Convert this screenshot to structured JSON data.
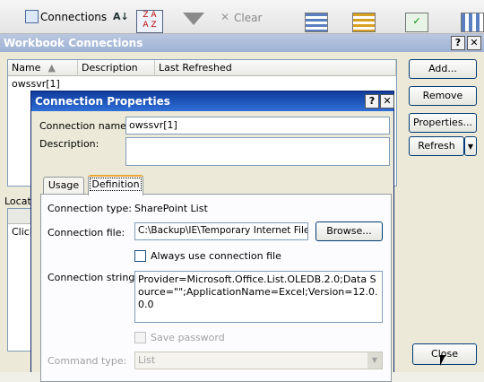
{
  "ribbon": {
    "connections_label": "Connections",
    "clear_label": "Clear"
  },
  "outer": {
    "title": "Workbook Connections",
    "columns": [
      "Name",
      "Description",
      "Last Refreshed"
    ],
    "rows": [
      {
        "name": "owssvr[1]"
      }
    ],
    "location_label": "Locatio",
    "click_label": "Click",
    "buttons": {
      "add": "Add...",
      "remove": "Remove",
      "properties": "Properties...",
      "refresh": "Refresh",
      "close": "Close"
    }
  },
  "inner": {
    "title": "Connection Properties",
    "connection_name_label": "Connection name:",
    "connection_name_value": "owssvr[1]",
    "description_label": "Description:",
    "description_value": "",
    "tabs": [
      "Usage",
      "Definition"
    ],
    "connection_type_label": "Connection type:",
    "connection_type_value": "SharePoint List",
    "connection_file_label": "Connection file:",
    "connection_file_value": "C:\\Backup\\IE\\Temporary Internet Files\\",
    "browse_label": "Browse...",
    "always_use_label": "Always use connection file",
    "connection_string_label": "Connection string:",
    "connection_string_value": "Provider=Microsoft.Office.List.OLEDB.2.0;Data Source=\"\";ApplicationName=Excel;Version=12.0.0.0",
    "save_password_label": "Save password",
    "command_type_label": "Command type:",
    "command_type_value": "List"
  }
}
